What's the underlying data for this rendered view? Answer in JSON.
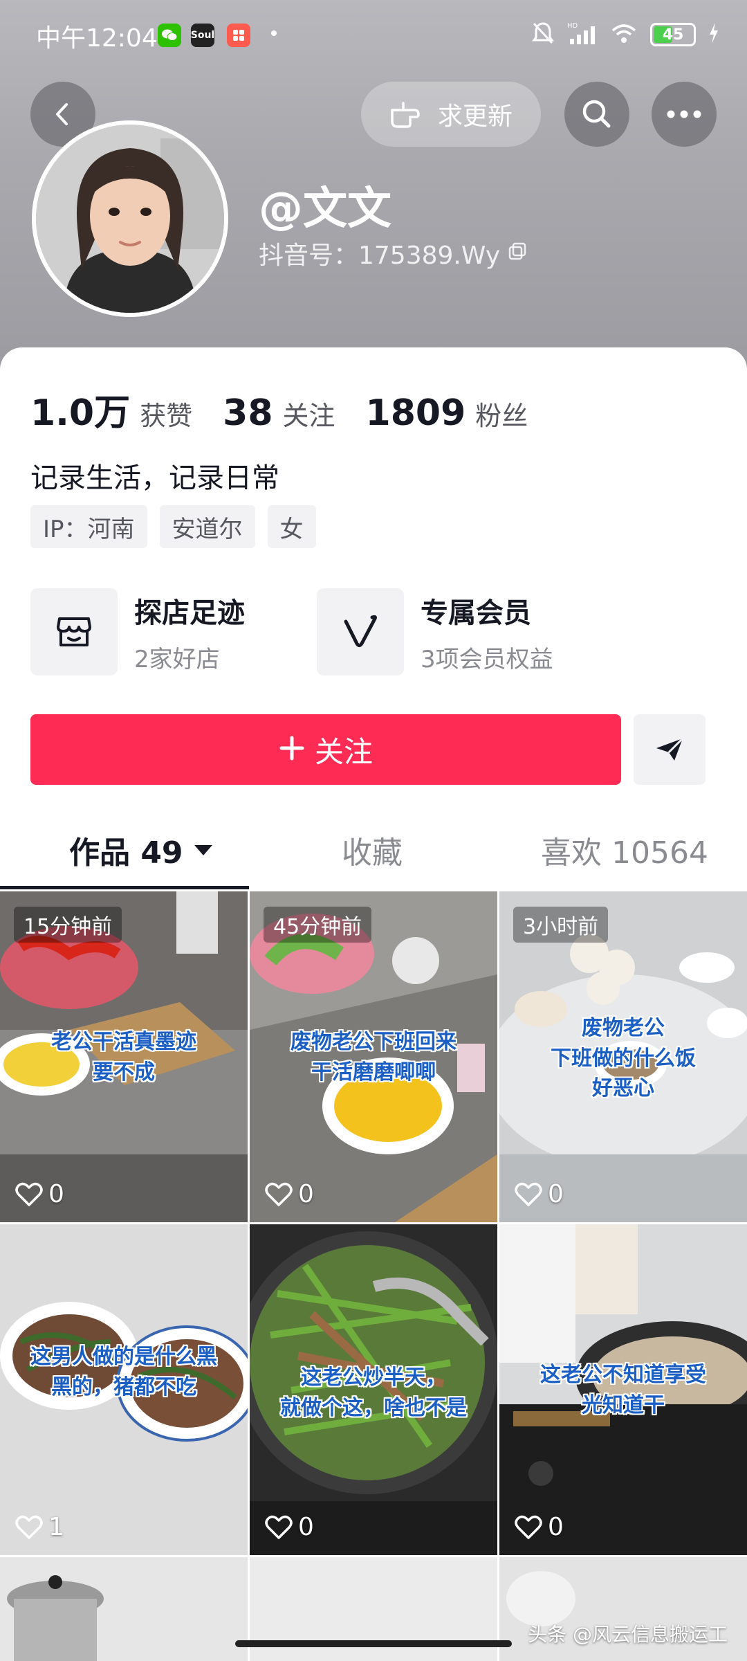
{
  "status_bar": {
    "time": "中午12:04",
    "apps": [
      "wechat-icon",
      "soul-icon",
      "app-icon"
    ],
    "soul_text": "Soul",
    "battery": "45"
  },
  "header": {
    "update_label": "求更新",
    "username": "@文文",
    "douyin_id": "抖音号：175389.Wy"
  },
  "stats": [
    {
      "num": "1.0万",
      "label": "获赞"
    },
    {
      "num": "38",
      "label": "关注"
    },
    {
      "num": "1809",
      "label": "粉丝"
    }
  ],
  "bio": "记录生活，记录日常",
  "tags": [
    "IP：河南",
    "安道尔",
    "女"
  ],
  "features": [
    {
      "title": "探店足迹",
      "sub": "2家好店",
      "icon": "shop-icon"
    },
    {
      "title": "专属会员",
      "sub": "3项会员权益",
      "icon": "v-icon"
    }
  ],
  "follow_label": "关注",
  "tabs": {
    "works": "作品 49",
    "favorites": "收藏",
    "likes": "喜欢 10564"
  },
  "videos": [
    {
      "time": "15分钟前",
      "caption": "老公干活真墨迹\n要不成",
      "likes": "0"
    },
    {
      "time": "45分钟前",
      "caption": "废物老公下班回来\n干活磨磨唧唧",
      "likes": "0"
    },
    {
      "time": "3小时前",
      "caption": "废物老公\n下班做的什么饭\n好恶心",
      "likes": "0"
    },
    {
      "time": "",
      "caption": "这男人做的是什么黑\n黑的，猪都不吃",
      "likes": "1"
    },
    {
      "time": "",
      "caption": "这老公炒半天，\n就做个这，啥也不是",
      "likes": "0"
    },
    {
      "time": "",
      "caption": "这老公不知道享受\n光知道干",
      "likes": "0"
    }
  ],
  "watermark": "头条 @风云信息搬运工",
  "colors": {
    "accent": "#fe2c55",
    "caption": "#1b5fc4"
  }
}
